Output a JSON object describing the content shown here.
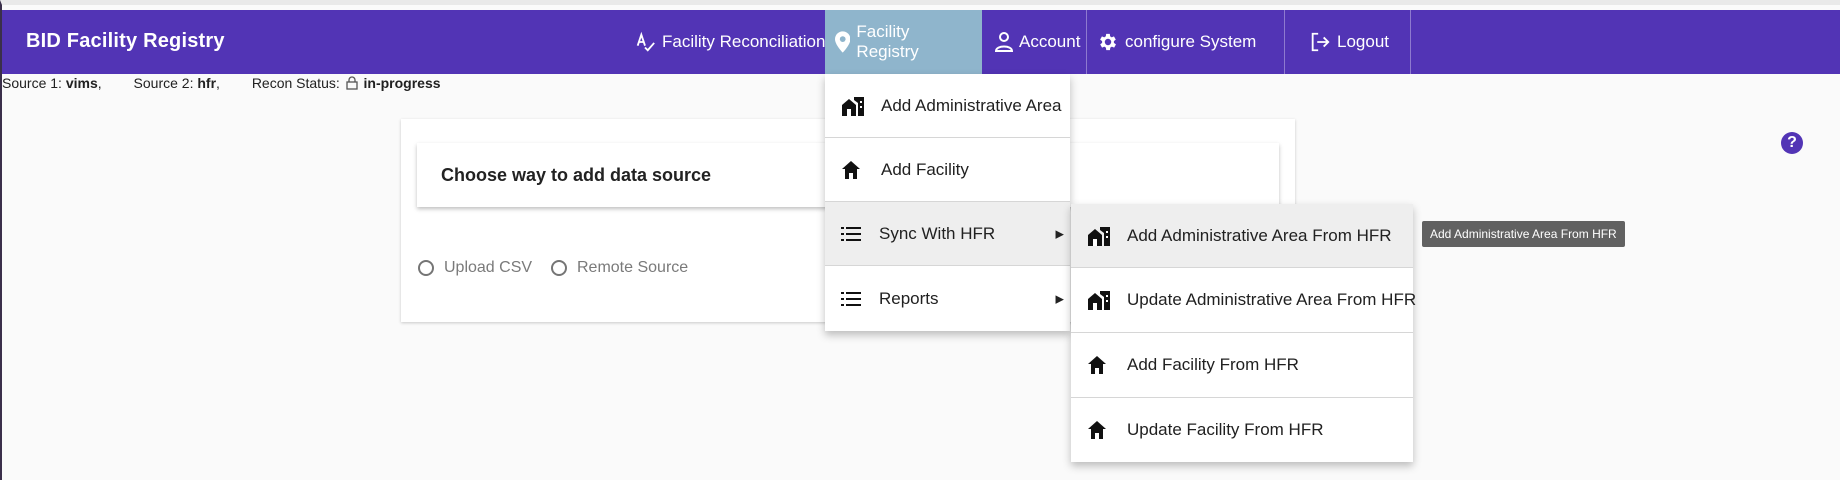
{
  "app": {
    "title": "BID Facility Registry"
  },
  "nav": {
    "reconciliation": "Facility Reconciliation",
    "registry": "Facility Registry",
    "account": "Account",
    "configure": "configure System",
    "logout": "Logout"
  },
  "status": {
    "source1_label": "Source 1:",
    "source1_value": "vims",
    "source2_label": "Source 2:",
    "source2_value": "hfr",
    "recon_label": "Recon Status:",
    "recon_value": "in-progress"
  },
  "card": {
    "title": "Choose way to add data source",
    "options": [
      "Upload CSV",
      "Remote Source"
    ]
  },
  "registry_menu": {
    "items": [
      "Add Administrative Area",
      "Add Facility",
      "Sync With HFR",
      "Reports"
    ]
  },
  "sync_menu": {
    "items": [
      "Add Administrative Area From HFR",
      "Update Administrative Area From HFR",
      "Add Facility From HFR",
      "Update Facility From HFR"
    ]
  },
  "tooltip": "Add Administrative Area From HFR",
  "help": "?",
  "colors": {
    "toolbar": "#5234b5",
    "active_tab": "#8fb5cc"
  }
}
